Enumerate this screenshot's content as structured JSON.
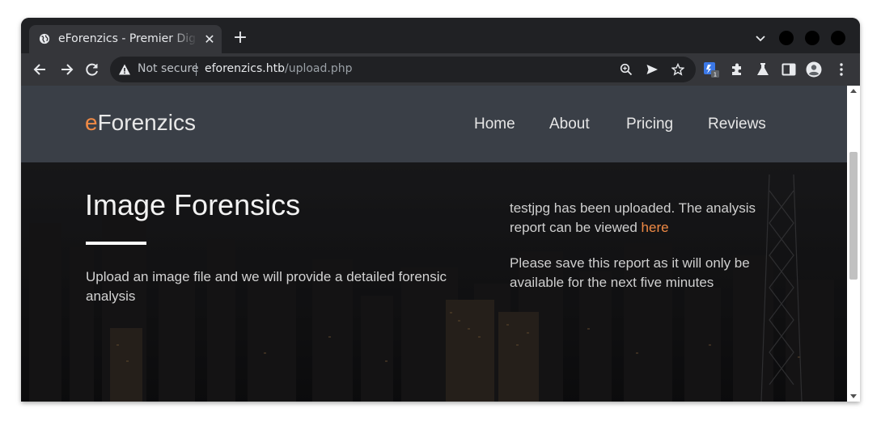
{
  "browser": {
    "tab": {
      "title": "eForenzics - Premier Digital Forensics",
      "close_glyph": "✕",
      "icon": "globe-icon"
    },
    "new_tab_glyph": "+",
    "omnibox": {
      "security_label": "Not secure",
      "url_domain": "eforenzics.htb",
      "url_path": "/upload.php"
    },
    "extension_badge": "1",
    "colors": {
      "chrome_dark": "#202124",
      "chrome_toolbar": "#35363a",
      "accent": "#f08a45"
    }
  },
  "site": {
    "brand": {
      "first_letter": "e",
      "rest": "Forenzics"
    },
    "nav": [
      {
        "label": "Home"
      },
      {
        "label": "About"
      },
      {
        "label": "Pricing"
      },
      {
        "label": "Reviews"
      }
    ],
    "hero": {
      "title": "Image Forensics",
      "description": "Upload an image file and we will provide a detailed forensic analysis"
    },
    "status": {
      "message_prefix": "testjpg has been uploaded. The analysis report can be viewed ",
      "link_text": "here",
      "notice": "Please save this report as it will only be available for the next five minutes"
    }
  }
}
